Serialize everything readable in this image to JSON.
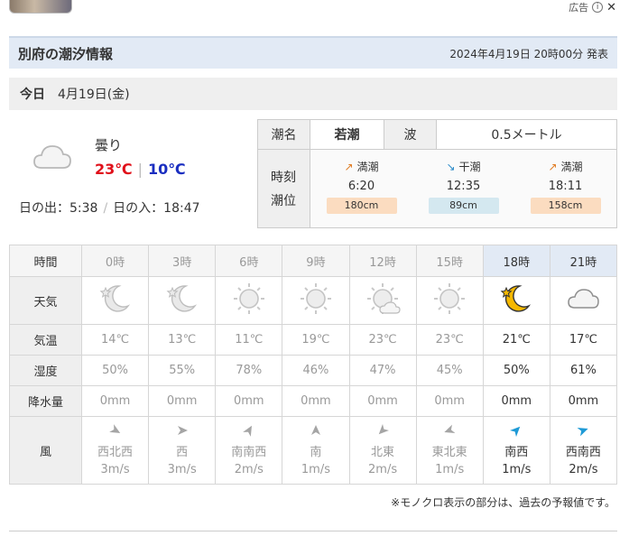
{
  "ad": {
    "label": "広告",
    "info_icon": "info-icon",
    "close_icon": "close-icon"
  },
  "header": {
    "title": "別府の潮汐情報",
    "issued": "2024年4月19日 20時00分 発表"
  },
  "date": {
    "today_label": "今日",
    "date": "4月19日(金)"
  },
  "current": {
    "condition": "曇り",
    "high": "23℃",
    "low": "10℃",
    "sunrise": "日の出：5:38",
    "sunset": "日の入：18:47",
    "icon": "cloud-icon"
  },
  "tide": {
    "name_label": "潮名",
    "name_value": "若潮",
    "wave_label": "波",
    "wave_value": "0.5メートル",
    "time_label": "時刻",
    "level_label": "潮位",
    "events": [
      {
        "type": "満潮",
        "arrow": "↗",
        "time": "6:20",
        "level": "180cm",
        "color": "#fbdcc0"
      },
      {
        "type": "干潮",
        "arrow": "↘",
        "time": "12:35",
        "level": "89cm",
        "color": "#d4e8f0"
      },
      {
        "type": "満潮",
        "arrow": "↗",
        "time": "18:11",
        "level": "158cm",
        "color": "#fbdcc0"
      }
    ]
  },
  "forecast": {
    "labels": {
      "time": "時間",
      "weather": "天気",
      "temp": "気温",
      "humidity": "湿度",
      "rain": "降水量",
      "wind": "風"
    },
    "hours": [
      {
        "time": "0時",
        "icon": "moon-icon",
        "temp": "14℃",
        "humidity": "50%",
        "rain": "0mm",
        "wind_dir": "西北西",
        "wind_speed": "3m/s",
        "wind_deg": 120,
        "past": true
      },
      {
        "time": "3時",
        "icon": "moon-icon",
        "temp": "13℃",
        "humidity": "55%",
        "rain": "0mm",
        "wind_dir": "西",
        "wind_speed": "3m/s",
        "wind_deg": 90,
        "past": true
      },
      {
        "time": "6時",
        "icon": "sun-icon",
        "temp": "11℃",
        "humidity": "78%",
        "rain": "0mm",
        "wind_dir": "南南西",
        "wind_speed": "2m/s",
        "wind_deg": 30,
        "past": true
      },
      {
        "time": "9時",
        "icon": "sun-icon",
        "temp": "19℃",
        "humidity": "46%",
        "rain": "0mm",
        "wind_dir": "南",
        "wind_speed": "1m/s",
        "wind_deg": 0,
        "past": true
      },
      {
        "time": "12時",
        "icon": "sun-cloud-icon",
        "temp": "23℃",
        "humidity": "47%",
        "rain": "0mm",
        "wind_dir": "北東",
        "wind_speed": "2m/s",
        "wind_deg": 225,
        "past": true
      },
      {
        "time": "15時",
        "icon": "sun-icon",
        "temp": "23℃",
        "humidity": "45%",
        "rain": "0mm",
        "wind_dir": "東北東",
        "wind_speed": "1m/s",
        "wind_deg": 250,
        "past": true
      },
      {
        "time": "18時",
        "icon": "moon-icon",
        "temp": "21℃",
        "humidity": "50%",
        "rain": "0mm",
        "wind_dir": "南西",
        "wind_speed": "1m/s",
        "wind_deg": 45,
        "past": false
      },
      {
        "time": "21時",
        "icon": "cloud-icon",
        "temp": "17℃",
        "humidity": "61%",
        "rain": "0mm",
        "wind_dir": "西南西",
        "wind_speed": "2m/s",
        "wind_deg": 70,
        "past": false
      }
    ]
  },
  "note": "※モノクロ表示の部分は、過去の予報値です。",
  "colors": {
    "accent_bg": "#e2eaf5",
    "high": "#e0101a",
    "low": "#1a2ec0",
    "moon": "#f5b800",
    "wind_active": "#1e9ad6"
  }
}
